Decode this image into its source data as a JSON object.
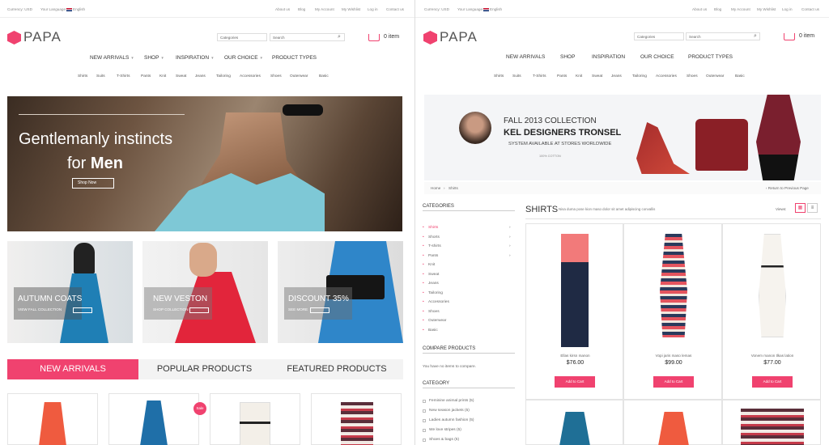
{
  "topbar": {
    "currency": "Currency: USD",
    "language": "Your Language:",
    "lang_value": "English",
    "links": [
      "About us",
      "Blog",
      "My Account",
      "My Wishlist",
      "Log in",
      "Contact us"
    ]
  },
  "brand": {
    "name": "PAPA"
  },
  "search": {
    "category": "Categories",
    "placeholder": "Search"
  },
  "cart": {
    "label": "0 item"
  },
  "menu": [
    "NEW ARRIVALS",
    "SHOP",
    "INSPIRATION",
    "OUR CHOICE",
    "PRODUCT TYPES"
  ],
  "submenu": [
    "Shirts",
    "Suits",
    "T-Shirts",
    "Pants",
    "Knit",
    "Sweat",
    "Jeans",
    "Tailoring",
    "Accessories",
    "Shoes",
    "Outerwear",
    "Basic"
  ],
  "hero": {
    "line1": "Gentlemanly instincts",
    "line2a": "for ",
    "line2b": "Men",
    "button": "Shop Now"
  },
  "promos": [
    {
      "title": "AUTUMN COATS",
      "sub": "VIEW FALL COLLECTION"
    },
    {
      "title": "NEW VESTON",
      "sub": "SHOP COLLECTION"
    },
    {
      "title": "DISCOUNT 35%",
      "sub": "SEE MORE"
    }
  ],
  "tabs": [
    "NEW ARRIVALS",
    "POPULAR PRODUCTS",
    "FEATURED PRODUCTS"
  ],
  "sale_badge": "Sale",
  "banner": {
    "line1": "FALL 2013 COLLECTION",
    "line2": "KEL DESIGNERS TRONSEL",
    "line3": "SYSTEM AVAILABLE AT STORES WORLDWIDE",
    "line4": "100% COTTON"
  },
  "breadcrumb": {
    "home": "Home",
    "sep": "›",
    "current": "Shirts",
    "back": "‹ Return to Previous Page"
  },
  "categories": {
    "title": "CATEGORIES",
    "items": [
      "Shirts",
      "Shorts",
      "T-shirts",
      "Pants",
      "Knit",
      "Sweat",
      "Jeans",
      "Tailoring",
      "Accessories",
      "Shoes",
      "Outerwear",
      "Basic"
    ]
  },
  "compare": {
    "title": "COMPARE PRODUCTS",
    "empty": "You have no items to compare."
  },
  "category": {
    "title": "CATEGORY",
    "items": [
      "Feminine animal prints (5)",
      "New season jackets (5)",
      "Ladies autumn fashion (5)",
      "We love stripes (5)",
      "Shoes & bags (5)"
    ]
  },
  "listing": {
    "title": "SHIRTS",
    "desc": "Nisa duma pose kion maso dolor sit amet adipiscing convallis",
    "views": "Views:"
  },
  "products": [
    {
      "name": "Ellas kirsn manon",
      "price": "$76.00",
      "button": "Add to Cart"
    },
    {
      "name": "Vopi jaris maso lemas",
      "price": "$99.00",
      "button": "Add to Cart"
    },
    {
      "name": "Vonem manon tlkas lation",
      "price": "$77.00",
      "button": "Add to Cart"
    }
  ],
  "colors": {
    "accent": "#f0426f"
  }
}
